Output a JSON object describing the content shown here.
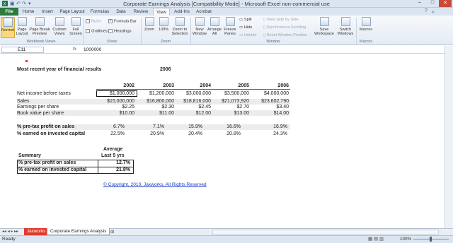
{
  "window": {
    "title": "Corporate Earnings Analysis  [Compatibility Mode]  -  Microsoft Excel non-commercial use",
    "buttons": [
      "–",
      "□",
      "✕"
    ]
  },
  "ribbon_tabs": [
    "File",
    "Home",
    "Insert",
    "Page Layout",
    "Formulas",
    "Data",
    "Review",
    "View",
    "Add-Ins",
    "Acrobat"
  ],
  "active_tab": "View",
  "ribbon": {
    "workbook_views": {
      "normal": "Normal",
      "page_layout": "Page Layout",
      "page_break": "Page Break Preview",
      "custom": "Custom Views",
      "full": "Full Screen",
      "group": "Workbook Views"
    },
    "show": {
      "ruler": "Ruler",
      "formula_bar": "Formula Bar",
      "gridlines": "Gridlines",
      "headings": "Headings",
      "group": "Show"
    },
    "zoom": {
      "zoom": "Zoom",
      "hundred": "100%",
      "to_selection": "Zoom to Selection",
      "group": "Zoom"
    },
    "window": {
      "new": "New Window",
      "arrange": "Arrange All",
      "freeze": "Freeze Panes",
      "split": "Split",
      "hide": "Hide",
      "unhide": "Unhide",
      "side_by_side": "View Side by Side",
      "sync_scroll": "Synchronous Scrolling",
      "reset_pos": "Reset Window Position",
      "save_ws": "Save Workspace",
      "switch": "Switch Windows",
      "group": "Window"
    },
    "macros": {
      "macros": "Macros",
      "group": "Macros"
    }
  },
  "formula_bar": {
    "name_box": "E11",
    "fx": "fx",
    "value": "1000000"
  },
  "sheet": {
    "heading": "Most recent year of financial results",
    "heading_year": "2006",
    "years": [
      "2002",
      "2003",
      "2004",
      "2005",
      "2006"
    ],
    "rows": [
      {
        "label": "Net income before taxes",
        "values": [
          "$1,000,000",
          "$1,200,000",
          "$3,000,000",
          "$3,500,000",
          "$4,000,000"
        ]
      },
      {
        "label": "Sales",
        "values": [
          "$15,000,000",
          "$16,800,000",
          "$18,816,000",
          "$21,073,920",
          "$23,602,790"
        ]
      },
      {
        "label": "Earnings per share",
        "values": [
          "$2.25",
          "$2.30",
          "$2.45",
          "$2.70",
          "$3.40"
        ]
      },
      {
        "label": "Book value per share",
        "values": [
          "$10.00",
          "$11.00",
          "$12.00",
          "$13.00",
          "$14.00"
        ]
      }
    ],
    "pct_rows": [
      {
        "label": "% pre-tax profit on sales",
        "values": [
          "6.7%",
          "7.1%",
          "15.9%",
          "16.6%",
          "16.9%"
        ]
      },
      {
        "label": "% earned on invested capital",
        "values": [
          "22.5%",
          "20.9%",
          "20.4%",
          "20.8%",
          "24.3%"
        ]
      }
    ],
    "summary": {
      "header_top": "Average",
      "header_bottom": "Last 5 yrs",
      "title": "Summary",
      "rows": [
        {
          "label": "% pre-tax profit on sales",
          "value": "12.7%"
        },
        {
          "label": "% earned on invested capital",
          "value": "21.8%"
        }
      ]
    },
    "copyright": "© Copyright, 2010, Jaxworks, All Rights Reserved"
  },
  "sheet_tabs": [
    "Jaxworks",
    "Corporate Earnings Analysis"
  ],
  "status": {
    "ready": "Ready",
    "zoom": "100%"
  },
  "colors": {
    "file_tab": "#2c7a3e",
    "jaxworks_tab": "#e03a2e",
    "link": "#1a3fc0"
  }
}
